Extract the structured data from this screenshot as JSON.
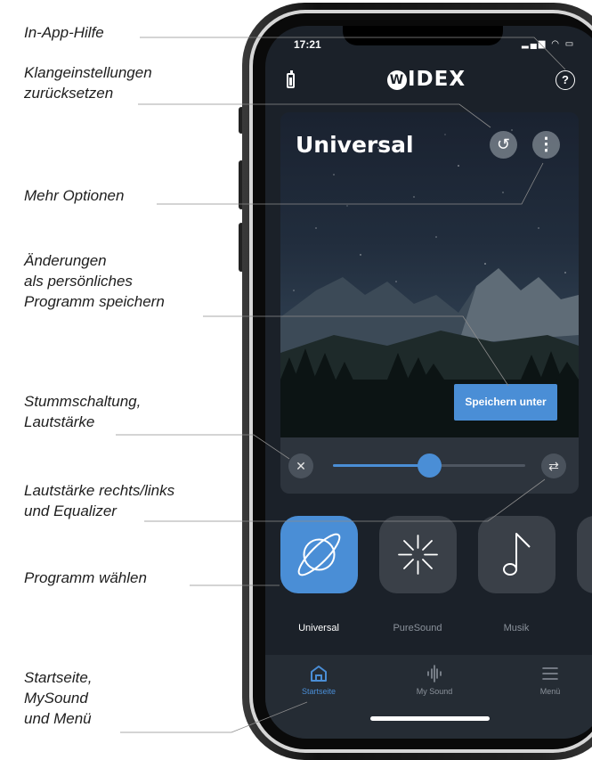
{
  "annotations": {
    "in_app_help": [
      "In-App-Hilfe"
    ],
    "reset_sound": [
      "Klangeinstellungen",
      "zurücksetzen"
    ],
    "more_options": [
      "Mehr Optionen"
    ],
    "save_changes": [
      "Änderungen",
      "als persönliches",
      "Programm speichern"
    ],
    "mute_volume": [
      "Stummschaltung,",
      "Lautstärke"
    ],
    "balance_eq": [
      "Lautstärke rechts/links",
      "und Equalizer"
    ],
    "choose_program": [
      "Programm wählen"
    ],
    "navigation": [
      "Startseite,",
      "MySound",
      "und Menü"
    ]
  },
  "status_bar": {
    "time": "17:21"
  },
  "header": {
    "logo_text": "IDEX",
    "help_glyph": "?"
  },
  "program": {
    "title": "Universal",
    "save_as_label": "Speichern unter"
  },
  "volume": {
    "level": 0.5
  },
  "programs": [
    {
      "label": "Universal",
      "icon": "planet-icon",
      "active": true
    },
    {
      "label": "PureSound",
      "icon": "starburst-icon",
      "active": false
    },
    {
      "label": "Musik",
      "icon": "music-note-icon",
      "active": false
    }
  ],
  "tabs": [
    {
      "label": "Startseite",
      "icon": "home-icon",
      "active": true
    },
    {
      "label": "My Sound",
      "icon": "soundwave-icon",
      "active": false
    },
    {
      "label": "Menü",
      "icon": "menu-icon",
      "active": false
    }
  ],
  "colors": {
    "accent": "#4a8ed6",
    "screen_background": "#1b2129",
    "tile_inactive": "#3a4048",
    "label_text": "#1e1e1e"
  }
}
